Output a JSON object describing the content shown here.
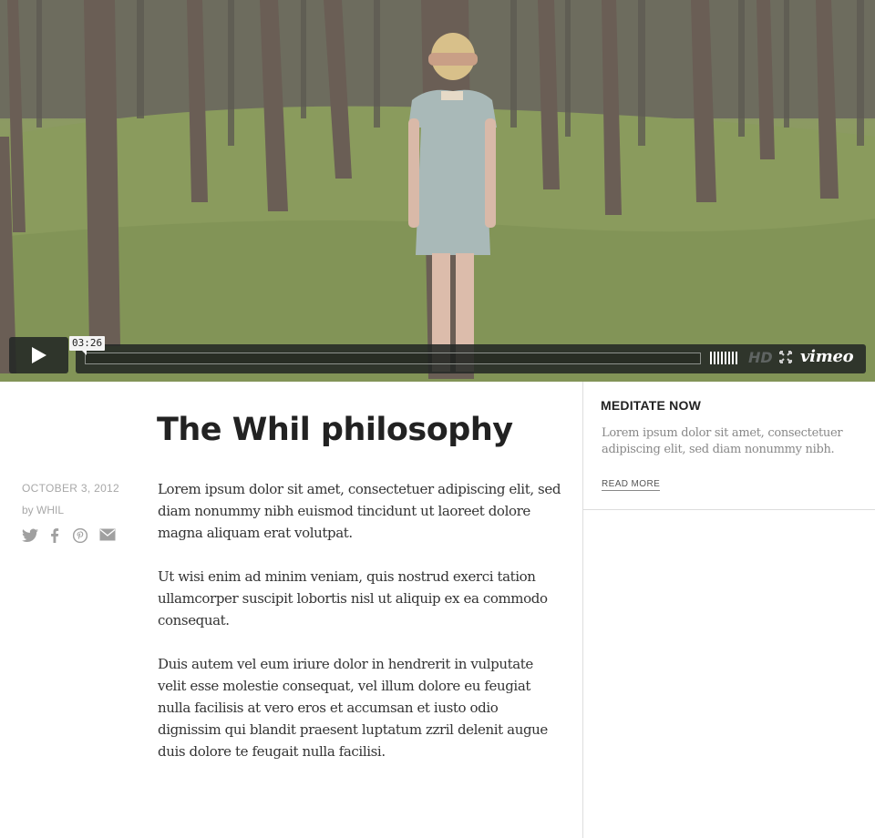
{
  "video": {
    "timecode": "03:26",
    "hd_label": "HD",
    "brand": "vimeo",
    "progress_fraction": 0
  },
  "article": {
    "title": "The Whil philosophy",
    "date": "OCTOBER 3, 2012",
    "byline": "by WHIL",
    "share_icons": [
      "twitter-icon",
      "facebook-icon",
      "pinterest-icon",
      "mail-icon"
    ],
    "paragraphs": [
      "Lorem ipsum dolor sit amet, consectetuer adipiscing elit, sed diam nonummy nibh euismod tincidunt ut laoreet dolore magna aliquam erat volutpat.",
      "Ut wisi enim ad minim veniam, quis nostrud exerci tation ullamcorper suscipit lobortis nisl ut aliquip ex ea commodo consequat.",
      "Duis autem vel eum iriure dolor in hendrerit in vulputate velit esse molestie consequat, vel illum dolore eu feugiat nulla facilisis at vero eros et accumsan et iusto odio dignissim qui blandit praesent luptatum zzril delenit augue duis dolore te feugait nulla facilisi."
    ]
  },
  "sidebar": {
    "title": "MEDITATE NOW",
    "text": "Lorem ipsum dolor sit amet, consectetuer adipiscing elit, sed diam nonummy nibh.",
    "read_more": "READ MORE"
  },
  "colors": {
    "control_bg": "#232826",
    "text_dark": "#222222",
    "text_muted": "#a8a8a8",
    "divider": "#dddddd"
  }
}
